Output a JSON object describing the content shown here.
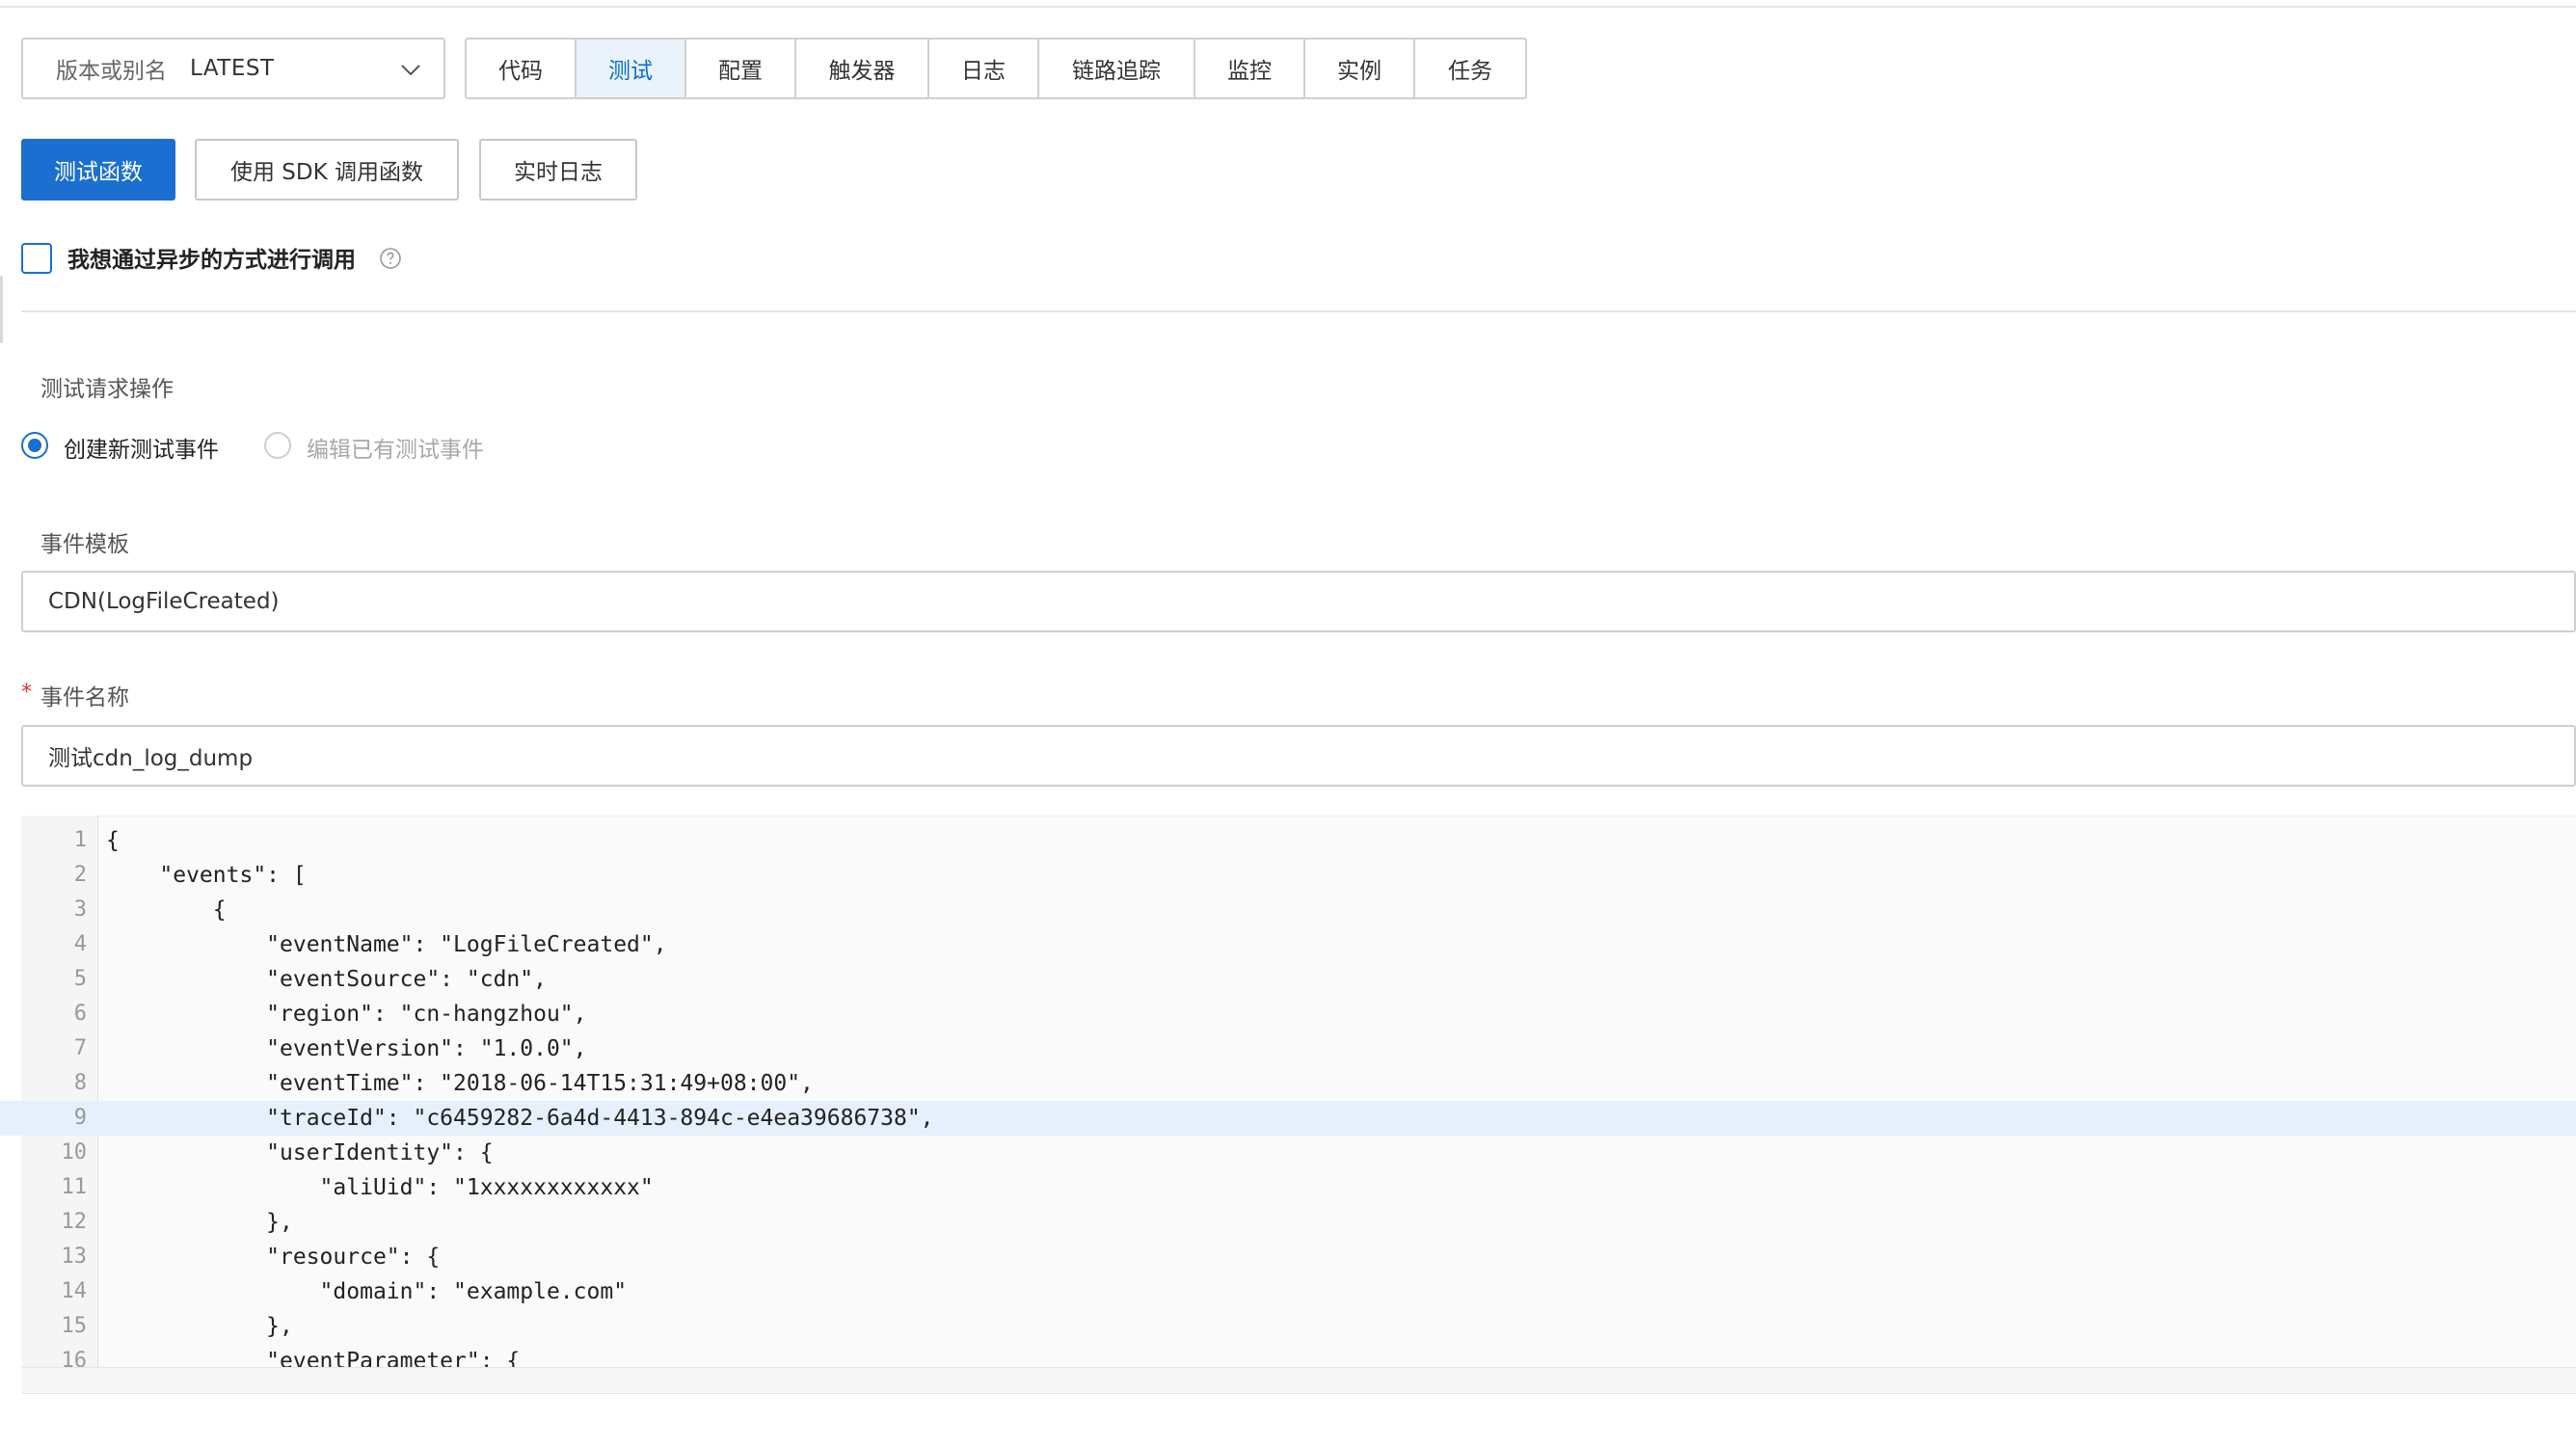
{
  "version": {
    "label": "版本或别名",
    "value": "LATEST"
  },
  "tabs": [
    {
      "label": "代码",
      "active": false
    },
    {
      "label": "测试",
      "active": true
    },
    {
      "label": "配置",
      "active": false
    },
    {
      "label": "触发器",
      "active": false
    },
    {
      "label": "日志",
      "active": false
    },
    {
      "label": "链路追踪",
      "active": false
    },
    {
      "label": "监控",
      "active": false
    },
    {
      "label": "实例",
      "active": false
    },
    {
      "label": "任务",
      "active": false
    }
  ],
  "actions": {
    "test_button": "测试函数",
    "sdk_button": "使用 SDK 调用函数",
    "realtime_log_button": "实时日志"
  },
  "async_checkbox": {
    "label": "我想通过异步的方式进行调用",
    "checked": false
  },
  "test_request": {
    "label": "测试请求操作",
    "options": [
      {
        "label": "创建新测试事件",
        "selected": true,
        "disabled": false
      },
      {
        "label": "编辑已有测试事件",
        "selected": false,
        "disabled": true
      }
    ]
  },
  "event_template": {
    "label": "事件模板",
    "value": "CDN(LogFileCreated)"
  },
  "event_name": {
    "required_mark": "*",
    "label": "事件名称",
    "value": "测试cdn_log_dump"
  },
  "editor": {
    "highlight_line": 9,
    "lines": [
      "{",
      "    \"events\": [",
      "        {",
      "            \"eventName\": \"LogFileCreated\",",
      "            \"eventSource\": \"cdn\",",
      "            \"region\": \"cn-hangzhou\",",
      "            \"eventVersion\": \"1.0.0\",",
      "            \"eventTime\": \"2018-06-14T15:31:49+08:00\",",
      "            \"traceId\": \"c6459282-6a4d-4413-894c-e4ea39686738\",",
      "            \"userIdentity\": {",
      "                \"aliUid\": \"1xxxxxxxxxxxx\"",
      "            },",
      "            \"resource\": {",
      "                \"domain\": \"example.com\"",
      "            },",
      "            \"eventParameter\": {"
    ]
  },
  "colors": {
    "accent": "#1a6fd0",
    "active_tab_bg": "#eaf2fb",
    "required": "#e0352b"
  },
  "icons": {
    "version_dropdown": "chevron-down-icon",
    "async_help": "question-circle-icon"
  }
}
